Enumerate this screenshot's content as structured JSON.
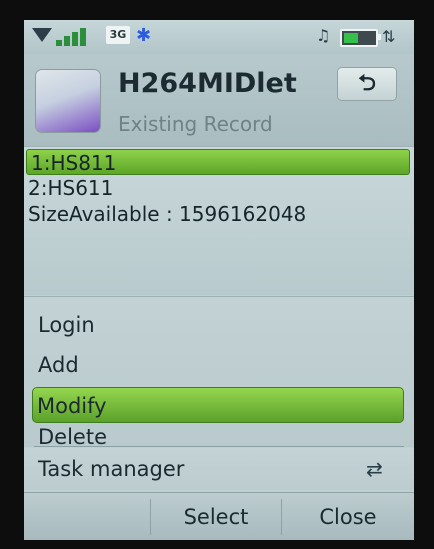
{
  "status_bar": {
    "network": "3G",
    "bluetooth_icon": "bluetooth-icon",
    "alarm_icon": "alarm-icon",
    "battery_level": 0.45,
    "sync_icon": "sync-icon",
    "signal_bars": 4
  },
  "header": {
    "title": "H264MIDlet",
    "subtitle": "Existing Record",
    "back_icon": "back-arrow-icon",
    "back_glyph": "⮌"
  },
  "records": [
    {
      "label": "1:HS811",
      "selected": true
    },
    {
      "label": "2:HS611",
      "selected": false
    },
    {
      "label": "SizeAvailable : 1596162048",
      "selected": false
    }
  ],
  "menu": {
    "items": [
      {
        "label": "Login",
        "selected": false
      },
      {
        "label": "Add",
        "selected": false
      },
      {
        "label": "Modify",
        "selected": true
      },
      {
        "label": "Delete",
        "selected": false
      }
    ],
    "task_manager": {
      "label": "Task manager",
      "icon": "task-switch-icon",
      "glyph": "⇄"
    }
  },
  "softkeys": {
    "left": "",
    "middle": "Select",
    "right": "Close"
  },
  "colors": {
    "selection_green": "#6fb83a",
    "screen_bg": "#bfd0d2"
  }
}
